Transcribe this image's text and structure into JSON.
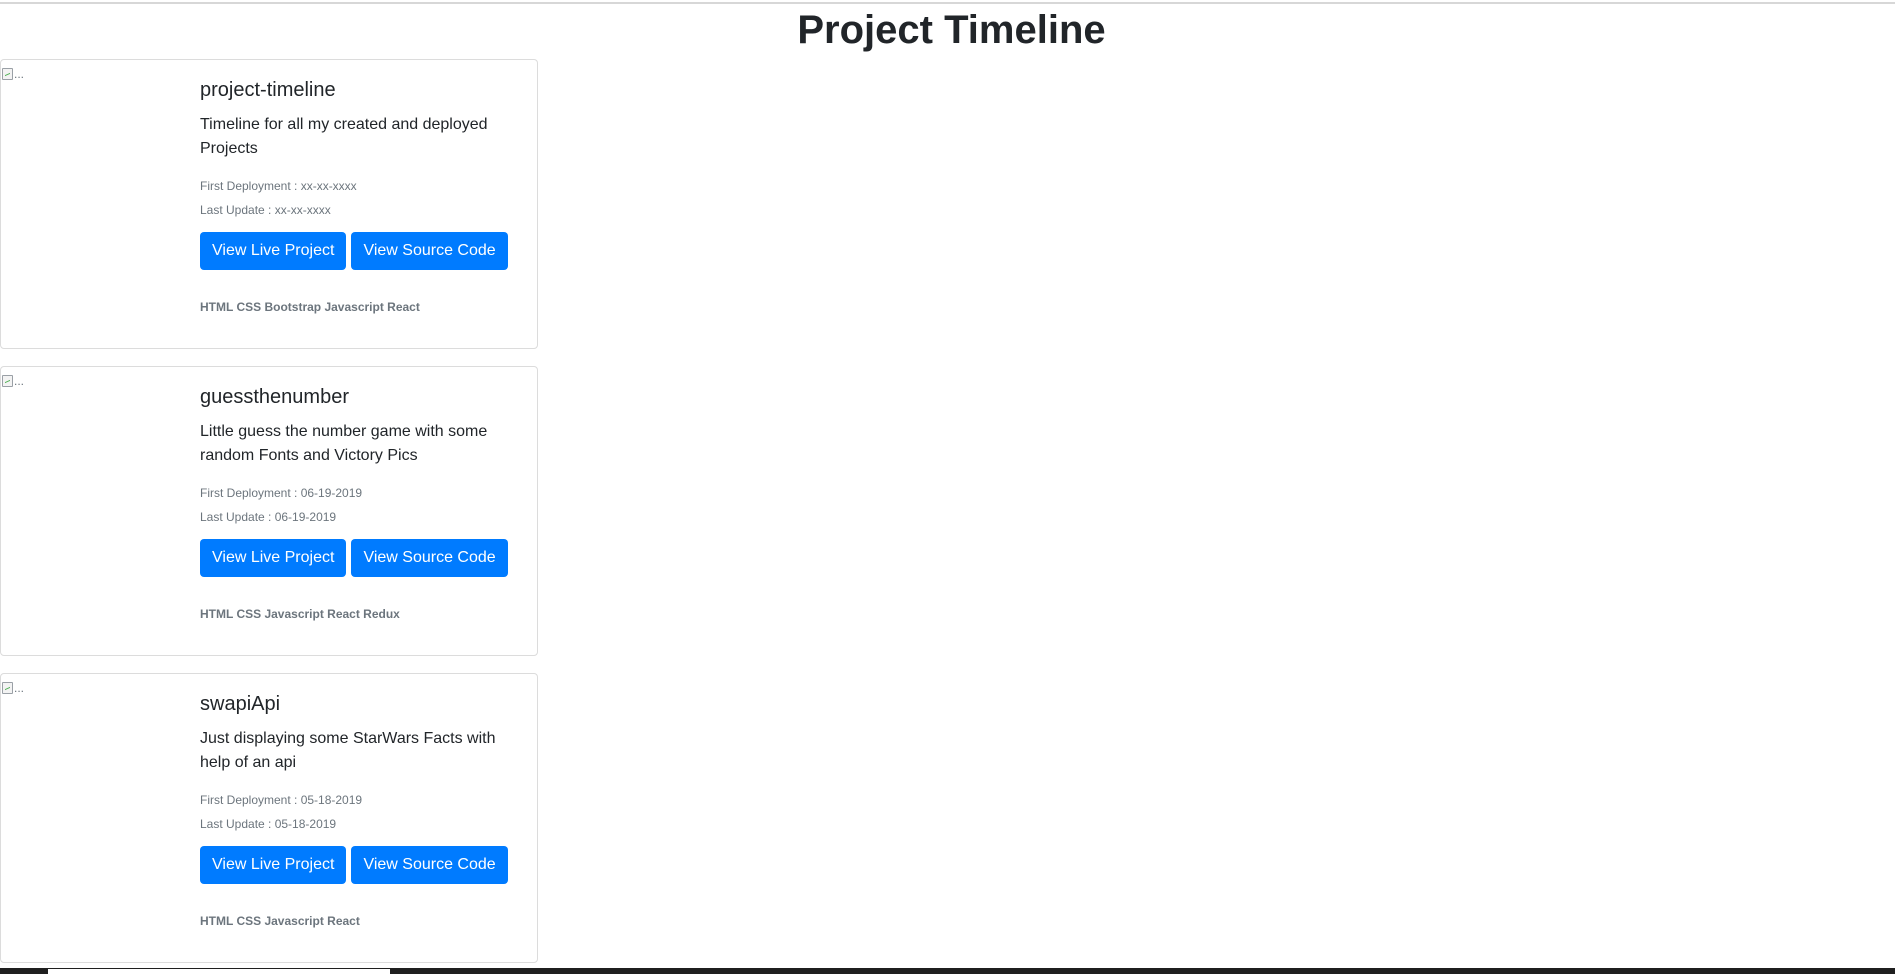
{
  "page": {
    "title": "Project Timeline"
  },
  "projects": [
    {
      "image_alt": "...",
      "name": "project-timeline",
      "description": "Timeline for all my created and deployed Projects",
      "first_deployment": "First Deployment : xx-xx-xxxx",
      "last_update": "Last Update : xx-xx-xxxx",
      "live_label": "View Live Project",
      "source_label": "View Source Code",
      "tech": "HTML CSS Bootstrap Javascript React"
    },
    {
      "image_alt": "...",
      "name": "guessthenumber",
      "description": "Little guess the number game with some random Fonts and Victory Pics",
      "first_deployment": "First Deployment : 06-19-2019",
      "last_update": "Last Update : 06-19-2019",
      "live_label": "View Live Project",
      "source_label": "View Source Code",
      "tech": "HTML CSS Javascript React Redux"
    },
    {
      "image_alt": "...",
      "name": "swapiApi",
      "description": "Just displaying some StarWars Facts with help of an api",
      "first_deployment": "First Deployment : 05-18-2019",
      "last_update": "Last Update : 05-18-2019",
      "live_label": "View Live Project",
      "source_label": "View Source Code",
      "tech": "HTML CSS Javascript React"
    }
  ],
  "colors": {
    "primary_button": "#007bff",
    "muted_text": "#6c757d",
    "card_border": "#dcdcdc"
  }
}
